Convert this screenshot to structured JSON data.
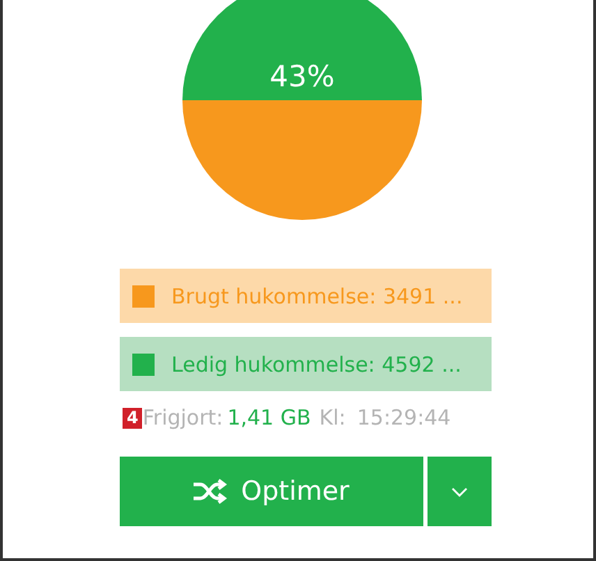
{
  "chart": {
    "label": "43%"
  },
  "legend": [
    {
      "kind": "used",
      "label": "Brugt hukommelse: 3491 ...",
      "color": "#f7981d"
    },
    {
      "kind": "free",
      "label": "Ledig hukommelse: 4592 ...",
      "color": "#22b14c"
    }
  ],
  "status": {
    "badge": "4",
    "freed_label": "Frigjort:",
    "freed_value": "1,41 GB",
    "time_label": "Kl:",
    "time": "15:29:44"
  },
  "button": {
    "label": "Optimer"
  }
}
